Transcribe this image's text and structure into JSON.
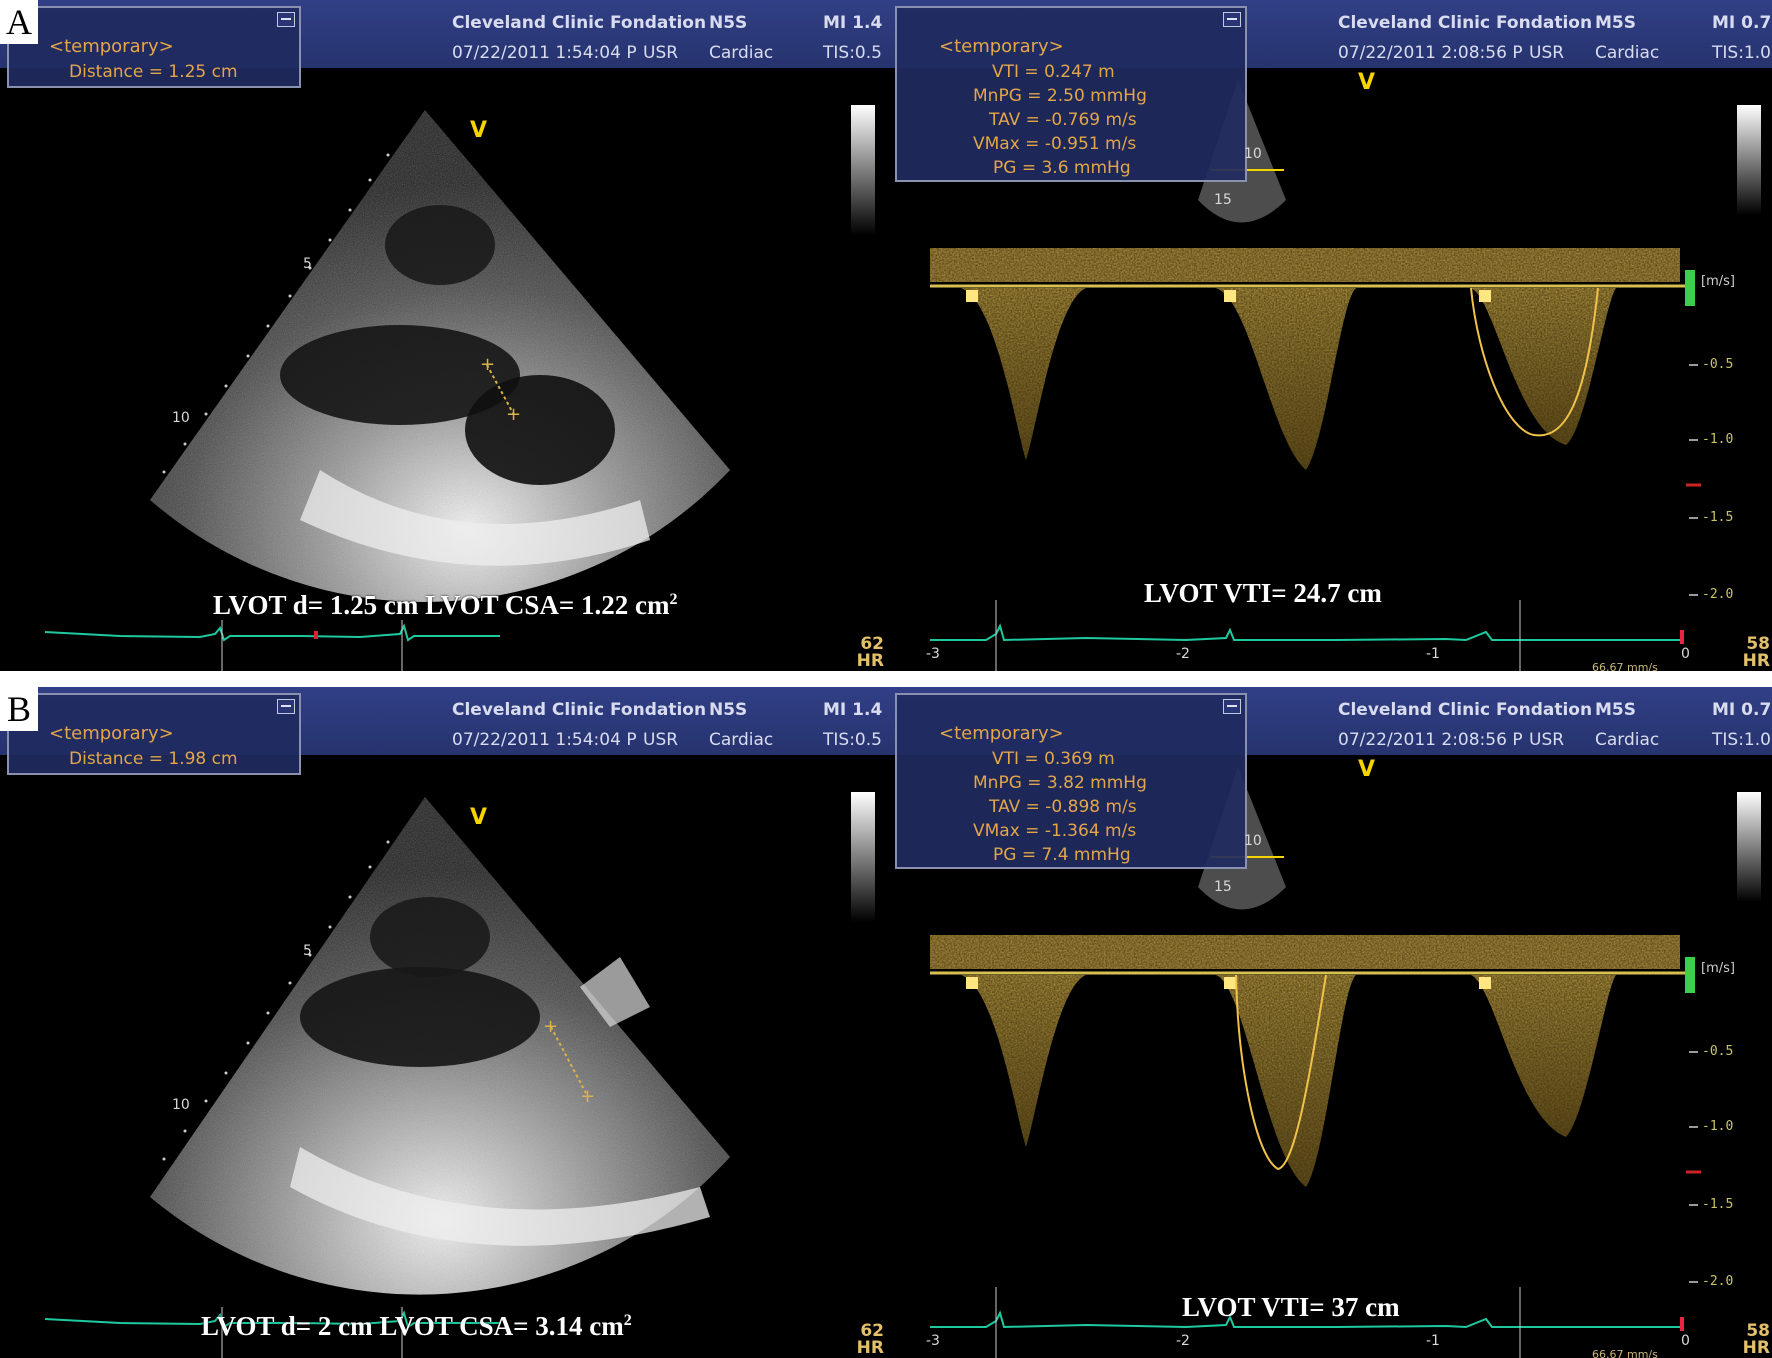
{
  "panels": [
    {
      "letter": "A",
      "left": {
        "header": {
          "line1": "Cleveland Clinic Fondation",
          "probe": "N5S",
          "mi": "MI 1.4",
          "datetime": "07/22/2011 1:54:04 P",
          "user": "USR",
          "preset": "Cardiac",
          "tis": "TIS:0.5"
        },
        "measure": {
          "title": "<temporary>",
          "distance": "Distance = 1.25 cm"
        },
        "depth_marks": [
          "5",
          "10"
        ],
        "probe_mark": "V",
        "caption_main": "LVOT d= 1.25 cm   LVOT CSA= 1.22 cm",
        "caption_sup": "2",
        "hr_value": "62",
        "hr_label": "HR"
      },
      "right": {
        "header": {
          "line1": "Cleveland Clinic Fondation",
          "probe": "M5S",
          "mi": "MI 0.7",
          "datetime": "07/22/2011 2:08:56 P",
          "user": "USR",
          "preset": "Cardiac",
          "tis": "TIS:1.0"
        },
        "measure": {
          "title": "<temporary>",
          "lines": [
            "VTI = 0.247   m",
            "MnPG = 2.50   mmHg",
            "TAV = -0.769 m/s",
            "VMax = -0.951 m/s",
            "PG = 3.6     mmHg"
          ]
        },
        "depth_marks": [
          "10",
          "15"
        ],
        "probe_mark": "V",
        "unit_label": "[m/s]",
        "y_ticks": [
          "-0.5",
          "-1.0",
          "-1.5",
          "-2.0"
        ],
        "x_ticks": [
          "-3",
          "-2",
          "-1",
          "0"
        ],
        "caption": "LVOT  VTI= 24.7 cm",
        "hr_value": "58",
        "hr_label": "HR",
        "sweep_speed": "66.67 mm/s",
        "traced_beat": 3
      }
    },
    {
      "letter": "B",
      "left": {
        "header": {
          "line1": "Cleveland Clinic Fondation",
          "probe": "N5S",
          "mi": "MI 1.4",
          "datetime": "07/22/2011 1:54:04 P",
          "user": "USR",
          "preset": "Cardiac",
          "tis": "TIS:0.5"
        },
        "measure": {
          "title": "<temporary>",
          "distance": "Distance = 1.98 cm"
        },
        "depth_marks": [
          "5",
          "10"
        ],
        "probe_mark": "V",
        "caption_main": "LVOT d= 2 cm   LVOT CSA= 3.14 cm",
        "caption_sup": "2",
        "hr_value": "62",
        "hr_label": "HR"
      },
      "right": {
        "header": {
          "line1": "Cleveland Clinic Fondation",
          "probe": "M5S",
          "mi": "MI 0.7",
          "datetime": "07/22/2011 2:08:56 P",
          "user": "USR",
          "preset": "Cardiac",
          "tis": "TIS:1.0"
        },
        "measure": {
          "title": "<temporary>",
          "lines": [
            "VTI = 0.369   m",
            "MnPG = 3.82   mmHg",
            "TAV = -0.898 m/s",
            "VMax = -1.364 m/s",
            "PG = 7.4     mmHg"
          ]
        },
        "depth_marks": [
          "10",
          "15"
        ],
        "probe_mark": "V",
        "unit_label": "[m/s]",
        "y_ticks": [
          "-0.5",
          "-1.0",
          "-1.5",
          "-2.0"
        ],
        "x_ticks": [
          "-3",
          "-2",
          "-1",
          "0"
        ],
        "caption": "LVOT  VTI= 37 cm",
        "hr_value": "58",
        "hr_label": "HR",
        "sweep_speed": "66.67 mm/s",
        "traced_beat": 2
      }
    }
  ],
  "colors": {
    "header_blue": "#2c3a7c",
    "measure_text": "#e3a64a",
    "ecg_trace": "#1fc9a0",
    "doppler_gold": "#d8a62a",
    "vti_trace": "#f0c24a"
  }
}
